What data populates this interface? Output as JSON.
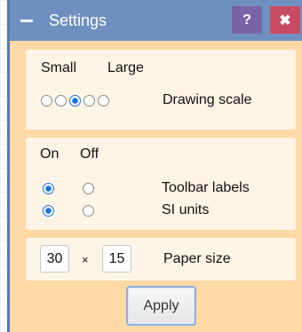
{
  "window": {
    "title": "Settings",
    "help_label": "?",
    "close_label": "✖",
    "collapse_icon": "minus-icon"
  },
  "scale": {
    "small_label": "Small",
    "large_label": "Large",
    "label": "Drawing scale",
    "options_count": 5,
    "selected_index": 2
  },
  "toggles": {
    "on_label": "On",
    "off_label": "Off",
    "toolbar_labels": {
      "label": "Toolbar labels",
      "value": "On"
    },
    "si_units": {
      "label": "SI units",
      "value": "On"
    }
  },
  "paper": {
    "width": "30",
    "times": "×",
    "height": "15",
    "label": "Paper size"
  },
  "apply_label": "Apply",
  "colors": {
    "panel_bg": "#ffd9a6",
    "section_bg": "#fff5e6",
    "titlebar": "#6f8fc0",
    "help_button": "#7a64a8",
    "close_button": "#c94b63",
    "radio_selected": "#1473e6"
  }
}
